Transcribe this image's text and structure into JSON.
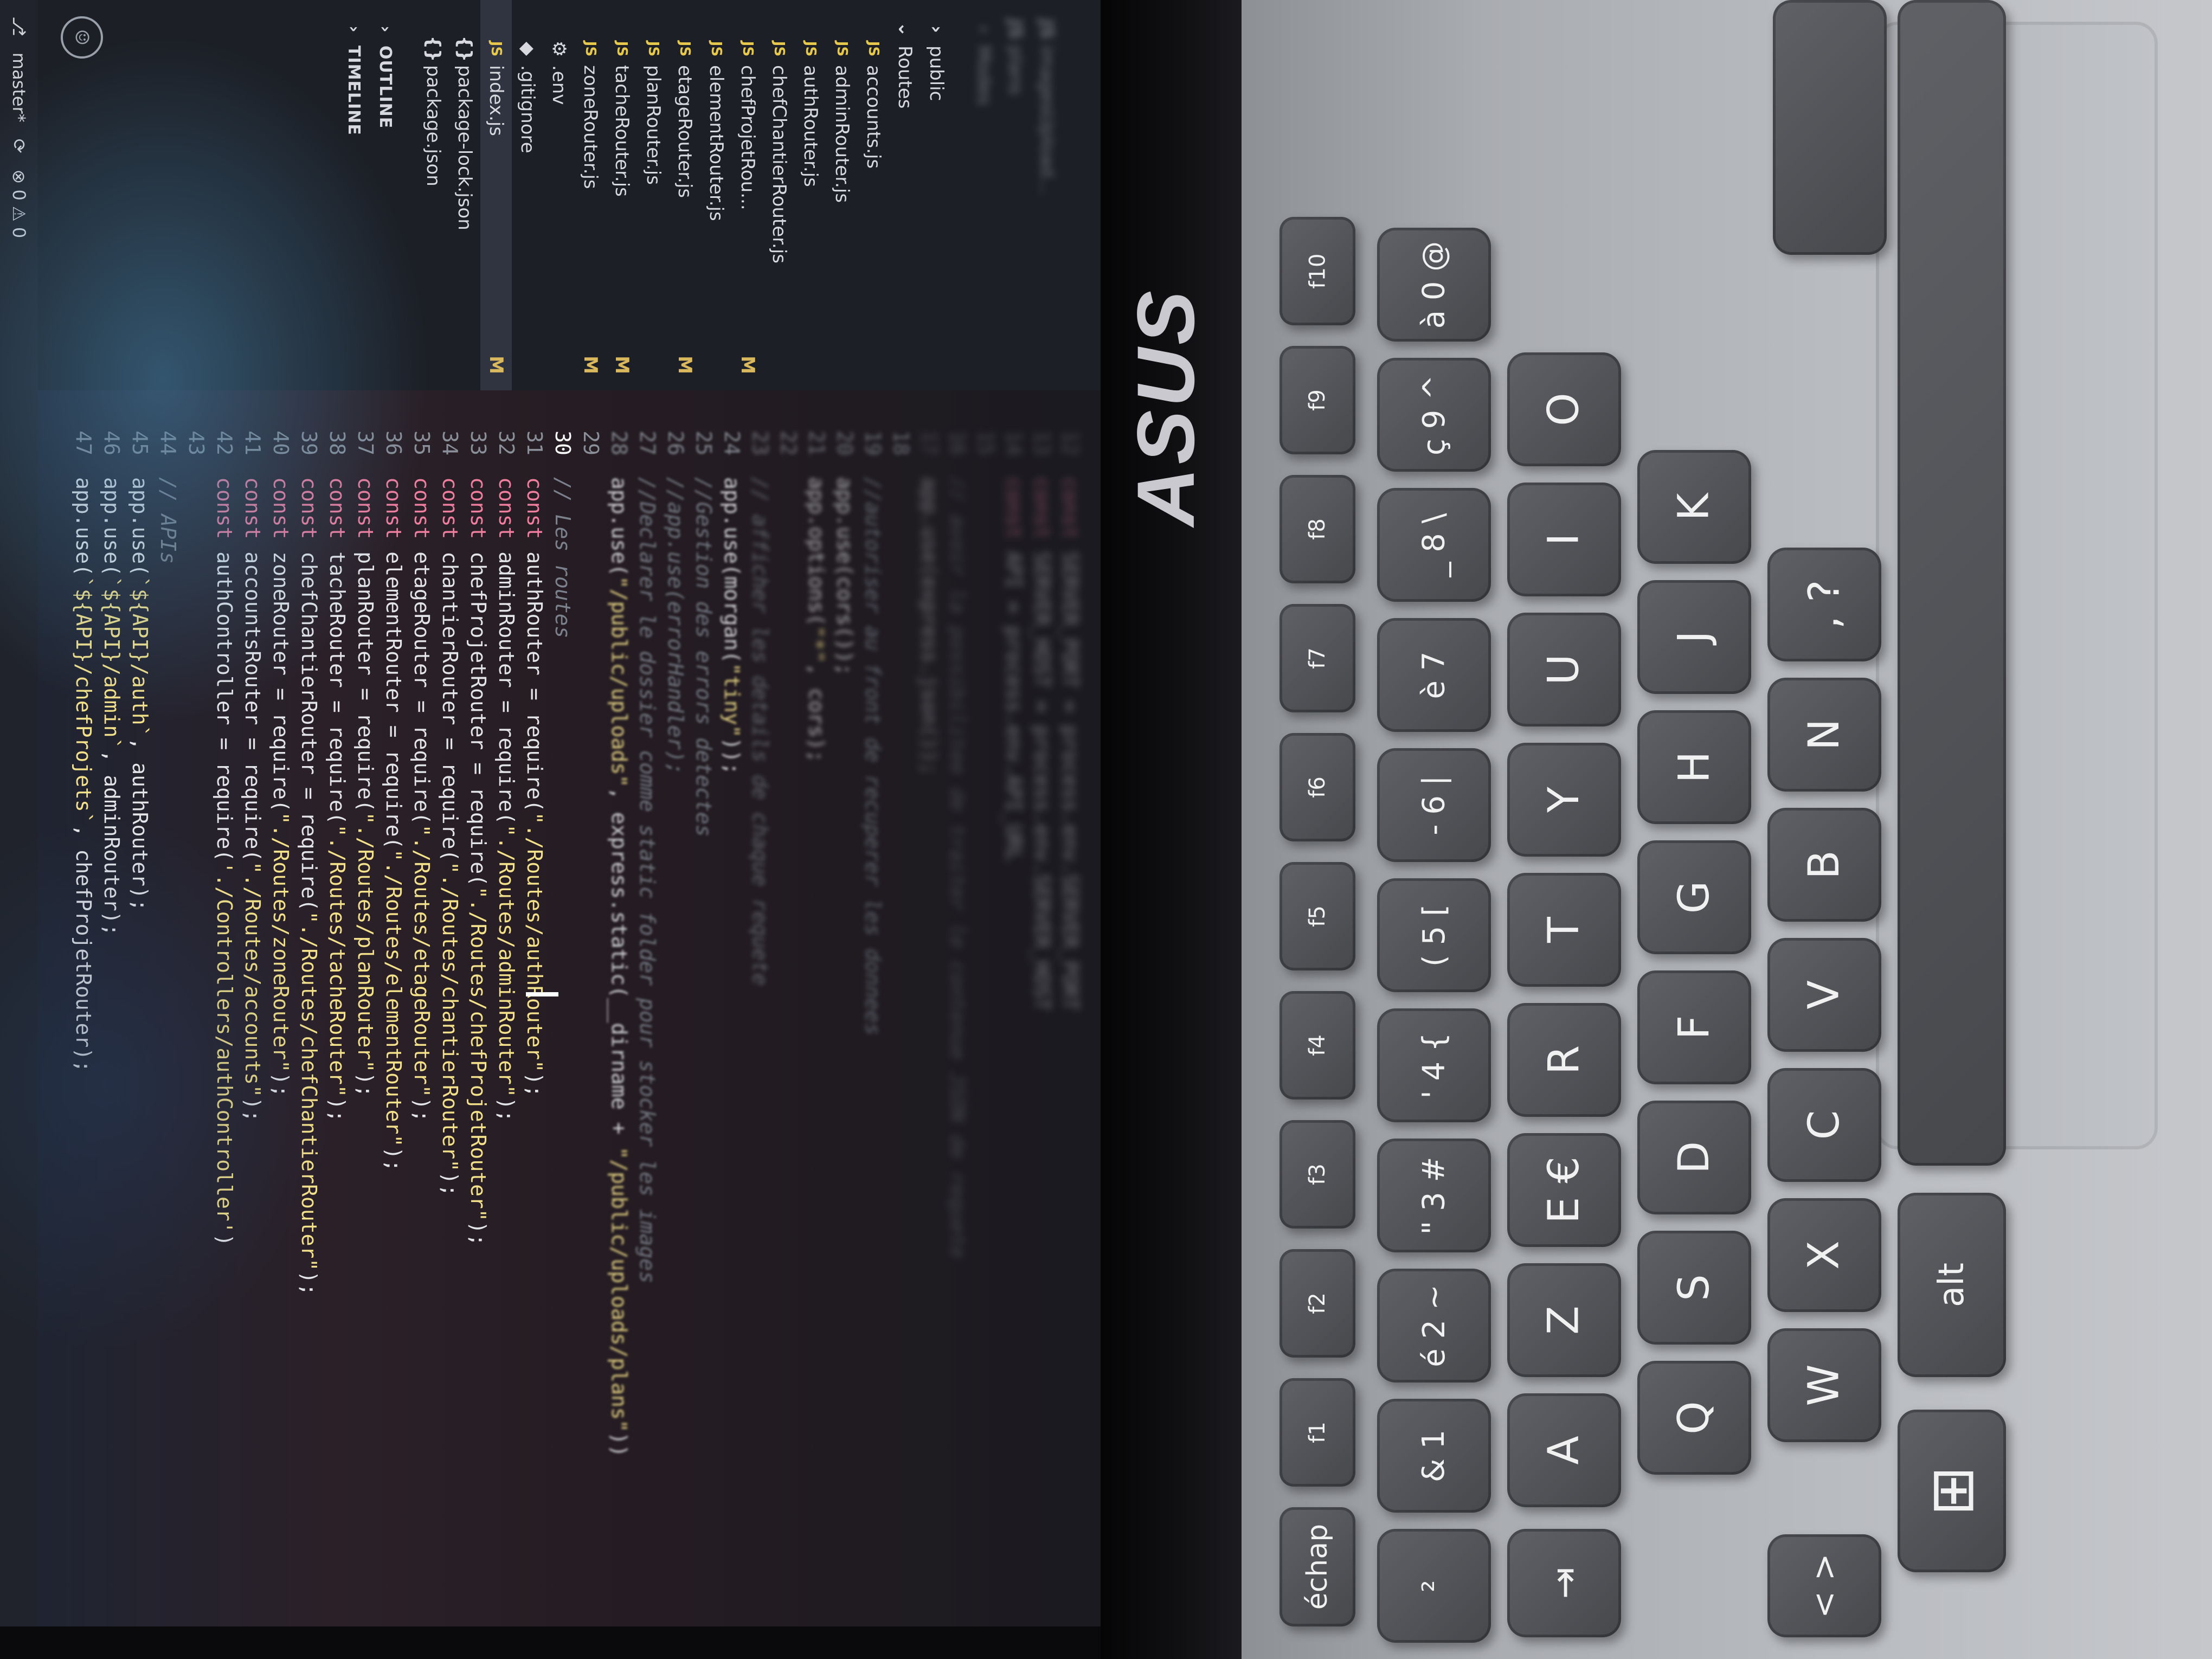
{
  "brand": "ASUS",
  "editor": {
    "sidebar": {
      "top_blurred": [
        {
          "name": "imagesUpload...",
          "icon": "js-icon"
        },
        {
          "name": "plans",
          "icon": "js-icon"
        },
        {
          "name": "Modes",
          "icon": "folder-icon"
        }
      ],
      "items": [
        {
          "name": "public",
          "type": "folder",
          "chevron": ">",
          "badge": ""
        },
        {
          "name": "Routes",
          "type": "folder",
          "chevron": "v",
          "badge": ""
        },
        {
          "name": "accounts.js",
          "type": "js",
          "badge": ""
        },
        {
          "name": "adminRouter.js",
          "type": "js",
          "badge": ""
        },
        {
          "name": "authRouter.js",
          "type": "js",
          "badge": ""
        },
        {
          "name": "chefChantierRouter.js",
          "type": "js",
          "badge": ""
        },
        {
          "name": "chefProjetRou...",
          "type": "js",
          "badge": "M"
        },
        {
          "name": "elementRouter.js",
          "type": "js",
          "badge": ""
        },
        {
          "name": "etageRouter.js",
          "type": "js",
          "badge": "M"
        },
        {
          "name": "planRouter.js",
          "type": "js",
          "badge": ""
        },
        {
          "name": "tacheRouter.js",
          "type": "js",
          "badge": "M"
        },
        {
          "name": "zoneRouter.js",
          "type": "js",
          "badge": "M"
        },
        {
          "name": ".env",
          "type": "gear",
          "badge": ""
        },
        {
          "name": ".gitignore",
          "type": "diamond",
          "badge": ""
        },
        {
          "name": "index.js",
          "type": "js",
          "badge": "M"
        },
        {
          "name": "package-lock.json",
          "type": "json",
          "badge": ""
        },
        {
          "name": "package.json",
          "type": "json",
          "badge": ""
        }
      ],
      "sections": [
        "OUTLINE",
        "TIMELINE"
      ]
    },
    "statusbar": {
      "branch": "master*",
      "problems": "⊗ 0 ⚠ 0"
    },
    "code_lines": [
      {
        "n": "12",
        "text": "const SERVER_PORT = process.env.SERVER_PORT"
      },
      {
        "n": "13",
        "text": "const SERVER_HOST = process.env.SERVER_HOST"
      },
      {
        "n": "14",
        "text": "const API = process.env.API_URL"
      },
      {
        "n": "15",
        "text": ""
      },
      {
        "n": "16",
        "text": "// avoir la possibilitee de traiter le contenue JSON de requete"
      },
      {
        "n": "17",
        "text": "app.use(express.json());"
      },
      {
        "n": "18",
        "text": ""
      },
      {
        "n": "19",
        "text": "//autoriser au front de recuperer les donnees"
      },
      {
        "n": "20",
        "text": "app.use(cors());"
      },
      {
        "n": "21",
        "text": "app.options(\"*\", cors);"
      },
      {
        "n": "22",
        "text": ""
      },
      {
        "n": "23",
        "text": "// afficher les details de chaque requete"
      },
      {
        "n": "24",
        "text": "app.use(morgan(\"tiny\"));"
      },
      {
        "n": "25",
        "text": "//Gestion des errors detectes"
      },
      {
        "n": "26",
        "text": "//app.use(errorHandler);"
      },
      {
        "n": "27",
        "text": "//Declarer le dossier comme static folder pour stocker les images"
      },
      {
        "n": "28",
        "text": "app.use(\"/public/uploads\", express.static(__dirname + \"/public/uploads/plans\"))"
      },
      {
        "n": "29",
        "text": ""
      },
      {
        "n": "30",
        "text": "// Les routes"
      },
      {
        "n": "31",
        "text": "const authRouter = require(\"./Routes/authRouter\");"
      },
      {
        "n": "32",
        "text": "const adminRouter = require(\"./Routes/adminRouter\");"
      },
      {
        "n": "33",
        "text": "const chefProjetRouter = require(\"./Routes/chefProjetRouter\");"
      },
      {
        "n": "34",
        "text": "const chantierRouter = require(\"./Routes/chantierRouter\");"
      },
      {
        "n": "35",
        "text": "const etageRouter = require(\"./Routes/etageRouter\");"
      },
      {
        "n": "36",
        "text": "const elementRouter = require(\"./Routes/elementRouter\");"
      },
      {
        "n": "37",
        "text": "const planRouter = require(\"./Routes/planRouter\");"
      },
      {
        "n": "38",
        "text": "const tacheRouter = require(\"./Routes/tacheRouter\");"
      },
      {
        "n": "39",
        "text": "const chefChantierRouter = require(\"./Routes/chefChantierRouter\");"
      },
      {
        "n": "40",
        "text": "const zoneRouter = require(\"./Routes/zoneRouter\");"
      },
      {
        "n": "41",
        "text": "const accountsRouter = require(\"./Routes/accounts\");"
      },
      {
        "n": "42",
        "text": "const authController = require('./Controllers/authController')"
      },
      {
        "n": "43",
        "text": ""
      },
      {
        "n": "44",
        "text": "// APIs"
      },
      {
        "n": "45",
        "text": "app.use(`${API}/auth`, authRouter);"
      },
      {
        "n": "46",
        "text": "app.use(`${API}/admin`, adminRouter);"
      },
      {
        "n": "47",
        "text": "app.use(`${API}/chefProjets`, chefProjetRouter);"
      }
    ]
  },
  "keyboard": {
    "fn_row": [
      "échap",
      "f1",
      "f2",
      "f3",
      "f4",
      "f5",
      "f6",
      "f7",
      "f8",
      "f9",
      "f10"
    ],
    "num_row": [
      "²",
      "& 1",
      "é 2 ~",
      "\" 3 #",
      "' 4 {",
      "( 5 [",
      "- 6 |",
      "è 7",
      "_ 8 \\",
      "ç 9 ^",
      "à 0 @"
    ],
    "row_a": [
      "A",
      "Z",
      "E €",
      "R",
      "T",
      "Y",
      "U",
      "I",
      "O"
    ],
    "row_q": [
      "Q",
      "S",
      "D",
      "F",
      "G",
      "H",
      "J",
      "K"
    ],
    "row_w": [
      "W",
      "X",
      "C",
      "V",
      "B",
      "N",
      ", ?"
    ],
    "bottom": [
      "⊞",
      "alt"
    ],
    "side": [
      "⇥",
      "< >"
    ]
  }
}
